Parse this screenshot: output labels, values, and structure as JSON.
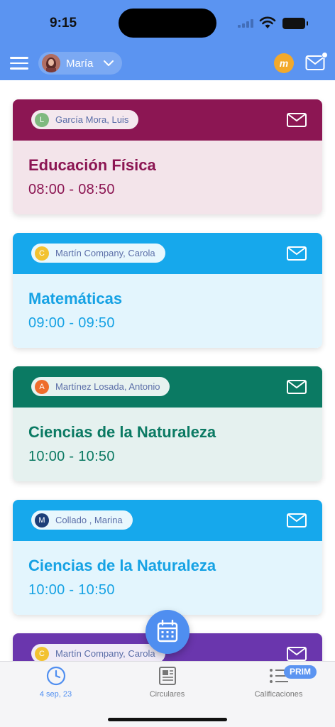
{
  "status": {
    "time": "9:15"
  },
  "header": {
    "profile_name": "María",
    "logo_text": "m"
  },
  "classes": [
    {
      "teacher": "García Mora, Luis",
      "initial": "L",
      "initial_color": "#7fb97f",
      "subject": "Educación Física",
      "time": "08:00 - 08:50",
      "head_color": "#8c1653",
      "body_color": "#f3e4ea",
      "text_color": "#8c1653"
    },
    {
      "teacher": "Martín Company, Carola",
      "initial": "C",
      "initial_color": "#f2c230",
      "subject": "Matemáticas",
      "time": "09:00 - 09:50",
      "head_color": "#16a8ec",
      "body_color": "#e3f5fd",
      "text_color": "#16a2e4"
    },
    {
      "teacher": "Martínez Losada, Antonio",
      "initial": "A",
      "initial_color": "#ee6d2c",
      "subject": "Ciencias de la Naturaleza",
      "time": "10:00 - 10:50",
      "head_color": "#0b7a63",
      "body_color": "#e5f1ef",
      "text_color": "#0b7a63"
    },
    {
      "teacher": "Collado , Marina",
      "initial": "M",
      "initial_color": "#1c3e78",
      "subject": "Ciencias de la Naturaleza",
      "time": "10:00 - 10:50",
      "head_color": "#16a8ec",
      "body_color": "#e3f5fd",
      "text_color": "#16a2e4"
    },
    {
      "teacher": "Martín Company, Carola",
      "initial": "C",
      "initial_color": "#f2c230",
      "subject": "",
      "time": "",
      "head_color": "#6a36ad",
      "body_color": "#efe7f7",
      "text_color": "#6a36ad"
    }
  ],
  "tabs": [
    {
      "label": "4 sep, 23",
      "icon": "clock-icon",
      "active": true
    },
    {
      "label": "Circulares",
      "icon": "newspaper-icon",
      "active": false
    },
    {
      "label": "Calificaciones",
      "icon": "list-icon",
      "active": false,
      "badge": "PRIM"
    }
  ],
  "colors": {
    "primary": "#5b94f1",
    "fab": "#4f8ef0"
  }
}
